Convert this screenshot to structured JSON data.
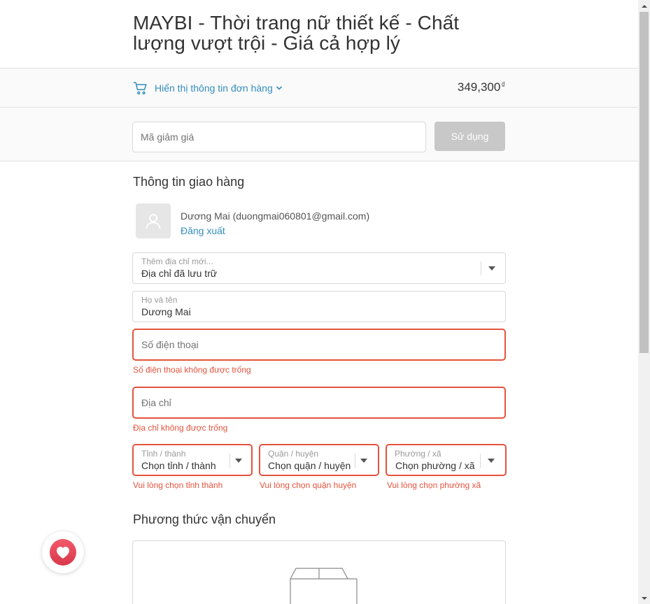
{
  "store": {
    "name": "MAYBI - Thời trang nữ thiết kế - Chất lượng vượt trội - Giá cả hợp lý"
  },
  "summary": {
    "toggle_label": "Hiển thị thông tin đơn hàng",
    "total": "349,300",
    "currency": "₫"
  },
  "discount": {
    "placeholder": "Mã giảm giá",
    "button": "Sử dụng"
  },
  "shipping_info": {
    "title": "Thông tin giao hàng",
    "user_name": "Dương Mai (duongmai060801@gmail.com)",
    "logout": "Đăng xuất",
    "saved_address": {
      "label": "Thêm địa chỉ mới...",
      "value": "Địa chỉ đã lưu trữ"
    },
    "full_name": {
      "label": "Họ và tên",
      "value": "Dương Mai"
    },
    "phone": {
      "placeholder": "Số điện thoại",
      "error": "Số điện thoại không được trống"
    },
    "address": {
      "placeholder": "Địa chỉ",
      "error": "Địa chỉ không được trống"
    },
    "province": {
      "label": "Tỉnh / thành",
      "value": "Chọn tỉnh / thành",
      "error": "Vui lòng chọn tỉnh thành"
    },
    "district": {
      "label": "Quận / huyện",
      "value": "Chọn quận / huyện",
      "error": "Vui lòng chọn quận huyện"
    },
    "ward": {
      "label": "Phường / xã",
      "value": "Chọn phường / xã",
      "error": "Vui lòng chọn phường xã"
    }
  },
  "shipping_method": {
    "title": "Phương thức vận chuyển"
  },
  "colors": {
    "accent": "#338dbc",
    "error": "#e5533c",
    "button_disabled": "#c8c8c8",
    "heart": "#e5485a"
  },
  "icons": [
    "cart-icon",
    "chevron-down-icon",
    "user-icon",
    "caret-down-icon",
    "box-icon",
    "heart-icon"
  ]
}
